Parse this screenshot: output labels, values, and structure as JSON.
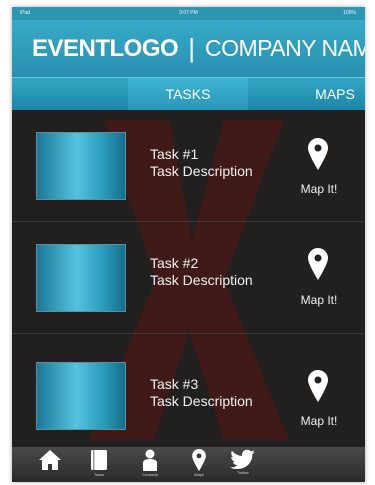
{
  "status": {
    "left": "iPad",
    "time": "9:07 PM",
    "battery": "100%"
  },
  "header": {
    "logo": "EVENTLOGO",
    "separator": "|",
    "company": "COMPANY NAME"
  },
  "tabs": [
    {
      "label": "TASKS",
      "active": true
    },
    {
      "label": "MAPS",
      "active": false
    }
  ],
  "tasks": [
    {
      "title": "Task #1",
      "description": "Task Description",
      "action": "Map It!"
    },
    {
      "title": "Task #2",
      "description": "Task Description",
      "action": "Map It!"
    },
    {
      "title": "Task #3",
      "description": "Task Description",
      "action": "Map It!"
    }
  ],
  "bottom_nav": [
    {
      "icon": "home-icon",
      "label": ""
    },
    {
      "icon": "notebook-icon",
      "label": "Tasks"
    },
    {
      "icon": "contacts-icon",
      "label": "Contacts"
    },
    {
      "icon": "map-pin-icon",
      "label": "Maps"
    },
    {
      "icon": "twitter-bird-icon",
      "label": "Twitter"
    }
  ],
  "colors": {
    "header": "#2d96b3",
    "background": "#221f1f",
    "watermark": "#5a1414"
  }
}
